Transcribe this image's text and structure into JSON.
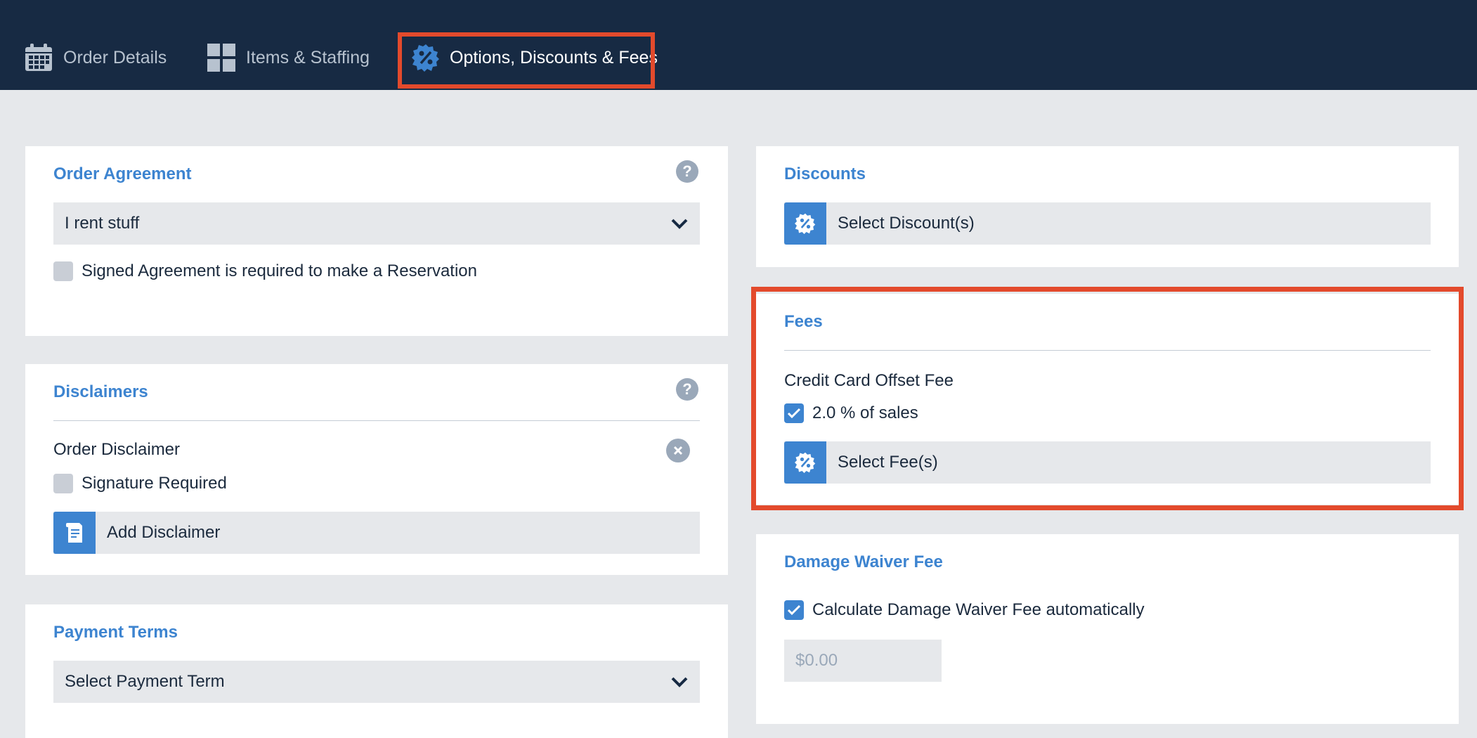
{
  "tabs": [
    {
      "label": "Order Details",
      "icon": "calendar-icon",
      "active": false
    },
    {
      "label": "Items & Staffing",
      "icon": "grid-icon",
      "active": false
    },
    {
      "label": "Options, Discounts & Fees",
      "icon": "percent-badge-icon",
      "active": true
    }
  ],
  "order_agreement": {
    "title": "Order Agreement",
    "help": "?",
    "selected": "I rent stuff",
    "signed_required_label": "Signed Agreement is required to make a Reservation",
    "signed_required": false
  },
  "disclaimers": {
    "title": "Disclaimers",
    "help": "?",
    "order_disclaimer_label": "Order Disclaimer",
    "signature_required_label": "Signature Required",
    "signature_required": false,
    "add_button_label": "Add Disclaimer"
  },
  "payment_terms": {
    "title": "Payment Terms",
    "selected": "Select Payment Term"
  },
  "discounts": {
    "title": "Discounts",
    "select_button_label": "Select Discount(s)"
  },
  "fees": {
    "title": "Fees",
    "fee_name": "Credit Card Offset Fee",
    "fee_option_label": "2.0 % of sales",
    "fee_option_checked": true,
    "select_button_label": "Select Fee(s)"
  },
  "damage_waiver": {
    "title": "Damage Waiver Fee",
    "auto_label": "Calculate Damage Waiver Fee automatically",
    "auto_checked": true,
    "amount_placeholder": "$0.00"
  },
  "colors": {
    "topbar": "#172a43",
    "accent": "#3d84d0",
    "highlight": "#e34a2c",
    "page_bg": "#e6e8eb"
  }
}
